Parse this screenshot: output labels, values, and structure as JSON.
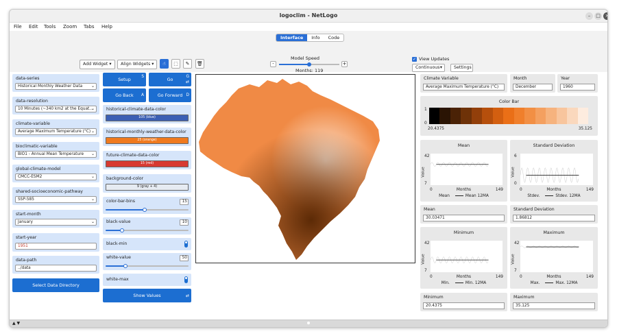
{
  "window": {
    "title": "logoclim - NetLogo"
  },
  "menu": [
    "File",
    "Edit",
    "Tools",
    "Zoom",
    "Tabs",
    "Help"
  ],
  "toolbar": {
    "tabs": [
      "Interface",
      "Info",
      "Code"
    ],
    "active_tab": "Interface",
    "add_widget": "Add Widget",
    "align_widgets": "Align Widgets",
    "model_speed_label": "Model Speed",
    "speed_minus": "-",
    "speed_plus": "+",
    "speed_value": 0.5,
    "ticks_label": "Months: 119",
    "view_updates_label": "View Updates",
    "view_updates_checked": true,
    "update_mode": "Continuous",
    "settings": "Settings"
  },
  "choosers": [
    {
      "label": "data-series",
      "value": "Historical Monthly Weather Data"
    },
    {
      "label": "data-resolution",
      "value": "10 Minutes (~340 km2 at the Equat..."
    },
    {
      "label": "climate-variable",
      "value": "Average Maximum Temperature (°C)"
    },
    {
      "label": "bioclimatic-variable",
      "value": "BIO1 - Annual Mean Temperature"
    },
    {
      "label": "global-climate-model",
      "value": "CMCC-ESM2"
    },
    {
      "label": "shared-socioeconomic-pathway",
      "value": "SSP-585"
    },
    {
      "label": "start-month",
      "value": "January"
    }
  ],
  "inputs": [
    {
      "label": "start-year",
      "value": "1951"
    },
    {
      "label": "data-path",
      "value": "../data"
    }
  ],
  "select_data_directory": "Select Data Directory",
  "buttons": {
    "setup": "Setup",
    "setup_key": "S",
    "go": "Go",
    "go_key": "G",
    "go_back": "Go Back",
    "go_back_key": "A",
    "go_forward": "Go Forward",
    "go_forward_key": "D",
    "show_values": "Show Values",
    "forever_glyph": "⇄"
  },
  "color_inputs": [
    {
      "label": "historical-climate-data-color",
      "value": "105 (blue)",
      "color": "#3b5fb4",
      "text_color": "#ffffff"
    },
    {
      "label": "historical-monthly-weather-data-color",
      "value": "25 (orange)",
      "color": "#f07a1e",
      "text_color": "#ffffff"
    },
    {
      "label": "future-climate-data-color",
      "value": "15 (red)",
      "color": "#d73a32",
      "text_color": "#ffffff"
    },
    {
      "label": "background-color",
      "value": "9 (gray + 4)",
      "color": "#e6ebf2",
      "text_color": "#222222"
    }
  ],
  "sliders": [
    {
      "label": "color-bar-bins",
      "value": "15",
      "fraction": 0.47
    },
    {
      "label": "black-value",
      "value": "10",
      "fraction": 0.2
    },
    {
      "label": "white-value",
      "value": "50",
      "fraction": 0.24
    }
  ],
  "switches": [
    {
      "label": "black-min",
      "on": true
    },
    {
      "label": "white-max",
      "on": true
    }
  ],
  "monitors": {
    "climate_variable": {
      "label": "Climate Variable",
      "value": "Average Maximum Temperature (°C)"
    },
    "month": {
      "label": "Month",
      "value": "December"
    },
    "year": {
      "label": "Year",
      "value": "1960"
    },
    "mean": {
      "label": "Mean",
      "value": "30.03471"
    },
    "sd": {
      "label": "Standard Deviation",
      "value": "1.86812"
    },
    "minimum": {
      "label": "Minimum",
      "value": "20.4375"
    },
    "maximum": {
      "label": "Maximum",
      "value": "35.125"
    }
  },
  "color_bar": {
    "title": "Color Bar",
    "ytop": "1",
    "ybottom": "0",
    "min_label": "20.4375",
    "max_label": "35.125",
    "bins": [
      "#000000",
      "#2a1404",
      "#4a2206",
      "#6e3208",
      "#923f0a",
      "#b64f0c",
      "#d35f10",
      "#ea6f17",
      "#f07f2b",
      "#f28f44",
      "#f4a060",
      "#f6b37e",
      "#f8c59d",
      "#fad8bd",
      "#fdecdf"
    ]
  },
  "plots": [
    {
      "title": "Mean",
      "ymax": "42",
      "ymin": "7",
      "ylabel": "Value",
      "xmin": "0",
      "xmax": "149",
      "xlabel": "Months",
      "legend": [
        "Mean",
        "Mean 12MA"
      ]
    },
    {
      "title": "Standard Deviation",
      "ymax": "6",
      "ymin": "0",
      "ylabel": "Value",
      "xmin": "0",
      "xmax": "149",
      "xlabel": "Months",
      "legend": [
        "Stdev.",
        "Stdev. 12MA"
      ]
    },
    {
      "title": "Minimum",
      "ymax": "42",
      "ymin": "7",
      "ylabel": "Value",
      "xmin": "0",
      "xmax": "149",
      "xlabel": "Months",
      "legend": [
        "Min.",
        "Min. 12MA"
      ]
    },
    {
      "title": "Maximum",
      "ymax": "42",
      "ymin": "7",
      "ylabel": "Value",
      "xmin": "0",
      "xmax": "149",
      "xlabel": "Months",
      "legend": [
        "Max.",
        "Max. 12MA"
      ]
    }
  ],
  "plot_series": {
    "mean": {
      "ma": 30.0,
      "spread": 2.2
    },
    "sd": {
      "ma": 1.9,
      "spread": 1.4
    },
    "min": {
      "ma": 20.6,
      "spread": 3.5
    },
    "max": {
      "ma": 35.1,
      "spread": 1.0
    },
    "ma_start": 12,
    "length": 120
  },
  "view": {
    "land_color": "#f08a45",
    "deep_color": "#5c2a06",
    "light_color": "#fde7d6"
  }
}
